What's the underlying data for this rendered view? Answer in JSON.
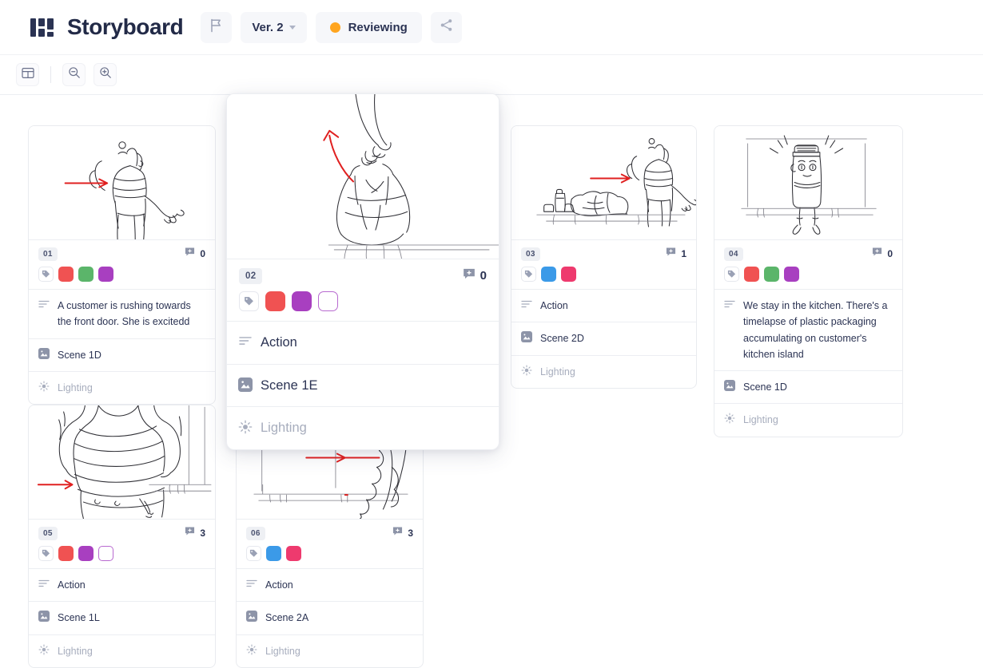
{
  "header": {
    "logo_icon": "storyboard-grid-logo",
    "title": "Storyboard",
    "flag_icon": "flag-icon",
    "version_label": "Ver. 2",
    "version_caret_icon": "chevron-down-icon",
    "status_label": "Reviewing",
    "status_dot_color": "#FFA51F",
    "share_icon": "share-icon"
  },
  "toolbar": {
    "grid_view_icon": "grid-view-icon",
    "zoom_out_icon": "zoom-out-icon",
    "zoom_in_icon": "zoom-in-icon"
  },
  "labels": {
    "tag_icon": "tag-icon",
    "comment_icon": "comment-add-icon",
    "action_icon": "text-lines-icon",
    "scene_icon": "image-icon",
    "lighting_icon": "sun-icon"
  },
  "palette": {
    "red": "#F05252",
    "green": "#5BB56A",
    "purple": "#A83FC0",
    "blue": "#3B9AE8",
    "pink": "#EE3A6E",
    "empty": "#FFFFFF"
  },
  "cards": [
    {
      "seq": "01",
      "comments": "0",
      "swatches": [
        "#F05252",
        "#5BB56A",
        "#A83FC0"
      ],
      "action": "A customer is rushing towards the front door. She is excitedd",
      "scene": "Scene 1D",
      "lighting": "Lighting",
      "sketch": "woman-walking-with-backpack"
    },
    {
      "seq": "02",
      "comments": "0",
      "swatches": [
        "#F05252",
        "#A83FC0",
        "#FFFFFF"
      ],
      "action": "Action",
      "scene": "Scene 1E",
      "lighting": "Lighting",
      "sketch": "hand-holding-shopping-bag"
    },
    {
      "seq": "03",
      "comments": "1",
      "swatches": [
        "#3B9AE8",
        "#EE3A6E"
      ],
      "action": "Action",
      "scene": "Scene 2D",
      "lighting": "Lighting",
      "sketch": "woman-standing-over-groceries"
    },
    {
      "seq": "04",
      "comments": "0",
      "swatches": [
        "#F05252",
        "#5BB56A",
        "#A83FC0"
      ],
      "action": "We stay in the kitchen. There's a timelapse of plastic packaging accumulating on customer's kitchen island",
      "scene": "Scene 1D",
      "lighting": "Lighting",
      "sketch": "jar-character-on-counter"
    },
    {
      "seq": "05",
      "comments": "3",
      "swatches": [
        "#F05252",
        "#A83FC0",
        "#FFFFFF"
      ],
      "action": "Action",
      "scene": "Scene 1L",
      "lighting": "Lighting",
      "sketch": "closeup-striped-shirt-torso"
    },
    {
      "seq": "06",
      "comments": "3",
      "swatches": [
        "#3B9AE8",
        "#EE3A6E"
      ],
      "action": "Action",
      "scene": "Scene 2A",
      "lighting": "Lighting",
      "sketch": "doorway-with-arrow"
    }
  ]
}
